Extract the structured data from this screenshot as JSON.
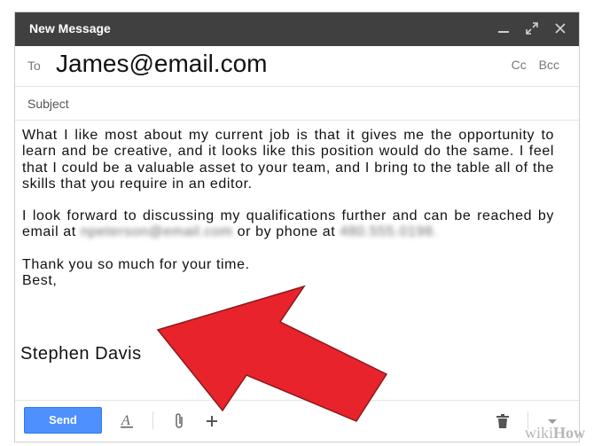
{
  "window": {
    "title": "New Message"
  },
  "to": {
    "label": "To",
    "value": "James@email.com",
    "cc": "Cc",
    "bcc": "Bcc"
  },
  "subject": {
    "label": "Subject",
    "value": ""
  },
  "body": {
    "p1": "What I like most about my current job is that it gives me the opportunity to learn and be creative, and it looks like this position would do the same. I feel that I could be a valuable asset to your team, and I bring to the table all of the skills that you require in an editor.",
    "p2_before": "I look forward to discussing my qualifications further and can be reached by email at",
    "p2_email": "npeterson@email.com",
    "p2_middle": "or by phone at",
    "p2_phone": "480.555.0198.",
    "thanks": "Thank you so much for your time.",
    "closing": "Best,",
    "signature": "Stephen  Davis"
  },
  "toolbar": {
    "send_label": "Send"
  },
  "watermark": {
    "text_wiki": "wiki",
    "text_how": "How"
  },
  "colors": {
    "titlebar": "#404040",
    "send": "#4d90fe",
    "arrow": "#e8232b"
  },
  "icons": [
    "minimize-icon",
    "expand-icon",
    "close-icon",
    "text-format-icon",
    "attach-icon",
    "insert-plus-icon",
    "trash-icon",
    "more-options-icon"
  ]
}
